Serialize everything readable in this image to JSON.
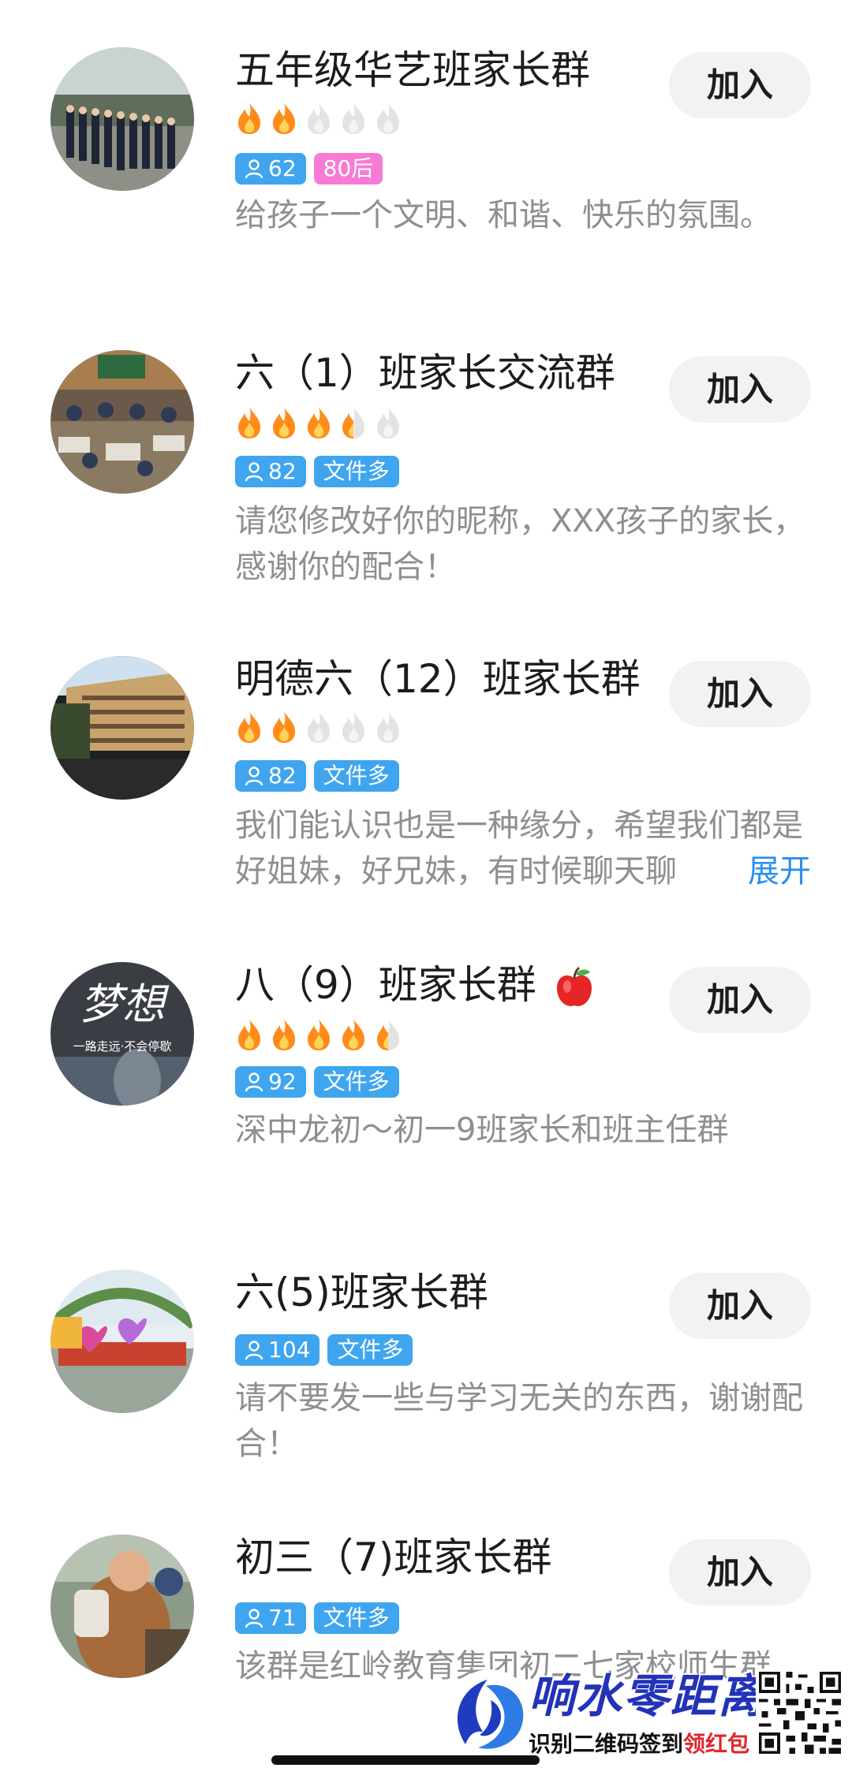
{
  "groups": [
    {
      "name": "五年级华艺班家长群",
      "flames_lit": 2,
      "flames_total": 5,
      "members": "62",
      "tags": [
        "80后"
      ],
      "description": "给孩子一个文明、和谐、快乐的氛围。",
      "join_label": "加入"
    },
    {
      "name": "六（1）班家长交流群",
      "flames_lit": 3.5,
      "flames_total": 5,
      "members": "82",
      "tags": [
        "文件多"
      ],
      "description": "请您修改好你的昵称，XXX孩子的家长，感谢你的配合！",
      "join_label": "加入"
    },
    {
      "name": "明德六（12）班家长群",
      "flames_lit": 2,
      "flames_total": 5,
      "members": "82",
      "tags": [
        "文件多"
      ],
      "description": "我们能认识也是一种缘分，希望我们都是好姐妹，好兄妹，有时候聊天聊",
      "expand_label": "展开",
      "join_label": "加入"
    },
    {
      "name": "八（9）班家长群",
      "flames_lit": 4.5,
      "flames_total": 5,
      "members": "92",
      "tags": [
        "文件多"
      ],
      "description": "深中龙初～初一9班家长和班主任群",
      "join_label": "加入"
    },
    {
      "name": "六(5)班家长群",
      "members": "104",
      "tags": [
        "文件多"
      ],
      "description": "请不要发一些与学习无关的东西，谢谢配合！",
      "join_label": "加入"
    },
    {
      "name": "初三（7)班家长群",
      "members": "71",
      "tags": [
        "文件多"
      ],
      "description": "该群是红岭教育集团初二七家校师生群",
      "join_label": "加入"
    }
  ],
  "avatar_text": {
    "group4_title": "梦想",
    "group4_caption": "一路走远·不会停歇"
  },
  "watermark": {
    "title": "响水零距离",
    "subtitle_black": "识别二维码签到",
    "subtitle_red": "领红包"
  },
  "colors": {
    "tag_blue": "#3fa5ef",
    "tag_pink": "#f77ad5",
    "flame_lit": "#ff8c1a",
    "flame_unlit": "#e3e3e6",
    "expand_link": "#2b8ff0",
    "join_button_bg": "#f2f2f4"
  }
}
